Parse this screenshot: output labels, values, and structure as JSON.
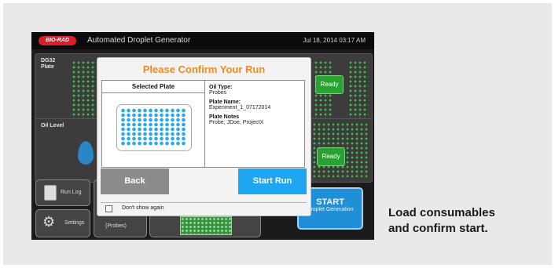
{
  "device": {
    "logo_text": "BIO-RAD",
    "app_title": "Automated Droplet Generator",
    "datetime": "Jul 18, 2014 03:17 AM",
    "blocks": {
      "dg32_label": "DG32\nPlate",
      "oil_level_label": "Oil Level",
      "ready_top": "Ready",
      "ready_bottom": "Ready"
    },
    "nav": {
      "run_log": "Run Log",
      "settings": "Settings",
      "probes": "(Probes)"
    },
    "start_button": {
      "line1": "START",
      "line2": "Droplet Generation"
    }
  },
  "dialog": {
    "title": "Please Confirm Your Run",
    "selected_plate_header": "Selected Plate",
    "oil_type_label": "Oil Type:",
    "oil_type_value": "Probes",
    "plate_name_label": "Plate Name:",
    "plate_name_value": "Experiment_1_07172014",
    "plate_notes_label": "Plate Notes",
    "plate_notes_value": "Probe, JDoe, ProjectX",
    "back_label": "Back",
    "start_run_label": "Start Run",
    "dont_show_label": "Don't show again",
    "dont_show_checked": false
  },
  "caption": {
    "line1": "Load consumables",
    "line2": "and confirm start."
  },
  "colors": {
    "accent_orange": "#f08a20",
    "start_blue": "#1ea6f2",
    "ready_green": "#2aa233",
    "brand_red": "#d71f2a"
  }
}
